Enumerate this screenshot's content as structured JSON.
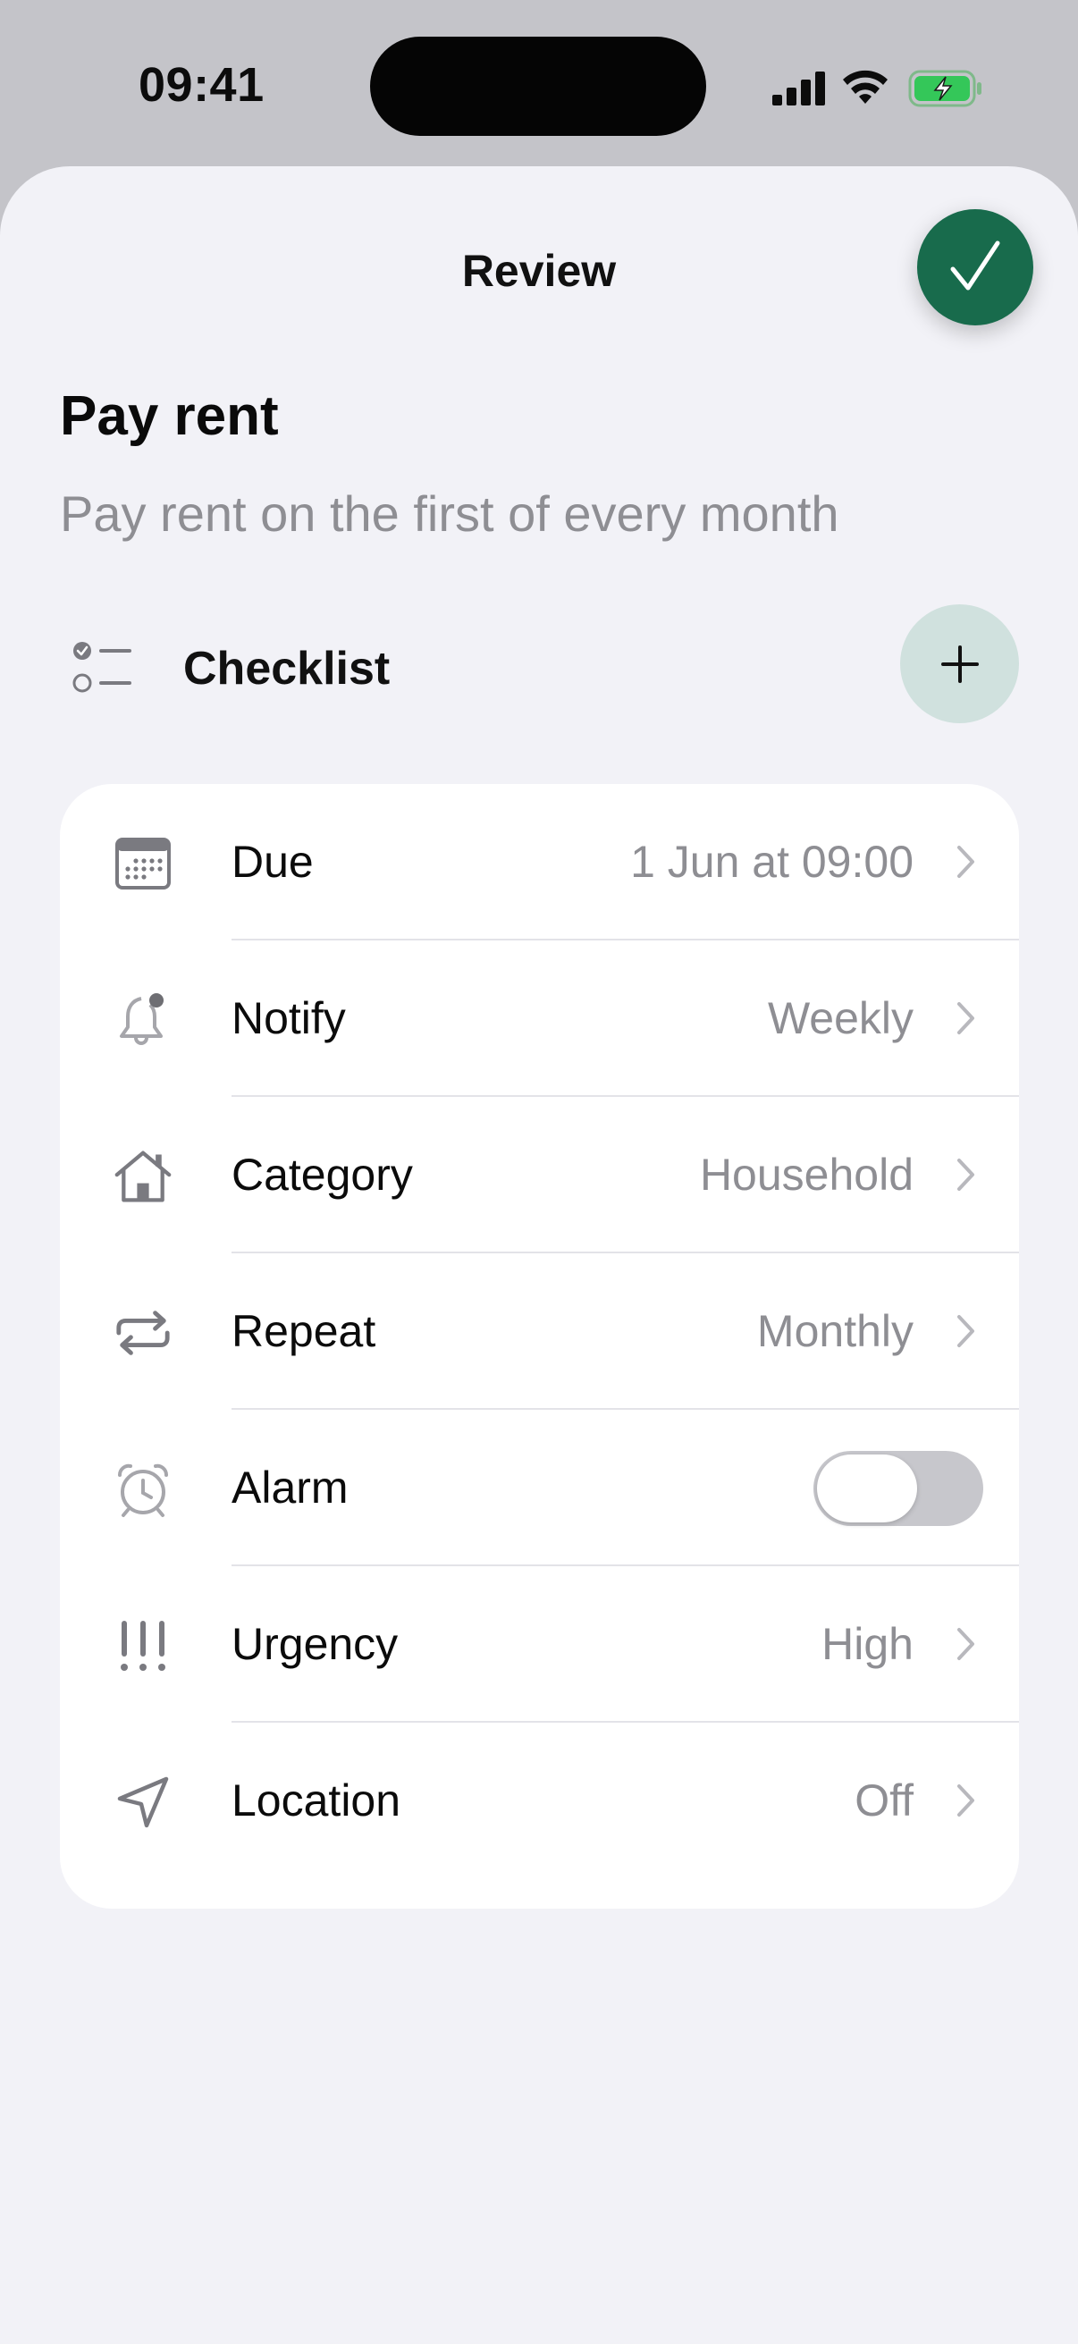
{
  "status_bar": {
    "time": "09:41"
  },
  "sheet": {
    "title": "Review"
  },
  "task": {
    "title": "Pay rent",
    "note": "Pay rent on the first of every month"
  },
  "checklist": {
    "label": "Checklist"
  },
  "colors": {
    "accent": "#186b4c",
    "add_button_bg": "#d0e1de",
    "secondary_text": "#8e8e93",
    "toggle_off": "#c7c7cc",
    "battery_green": "#34c759"
  },
  "rows": [
    {
      "icon": "calendar-icon",
      "label": "Due",
      "value": "1 Jun at 09:00"
    },
    {
      "icon": "bell-icon",
      "label": "Notify",
      "value": "Weekly"
    },
    {
      "icon": "house-icon",
      "label": "Category",
      "value": "Household"
    },
    {
      "icon": "repeat-icon",
      "label": "Repeat",
      "value": "Monthly"
    },
    {
      "icon": "alarm-clock-icon",
      "label": "Alarm",
      "toggle": false
    },
    {
      "icon": "exclamation-icon",
      "label": "Urgency",
      "value": "High"
    },
    {
      "icon": "location-arrow-icon",
      "label": "Location",
      "value": "Off"
    }
  ]
}
